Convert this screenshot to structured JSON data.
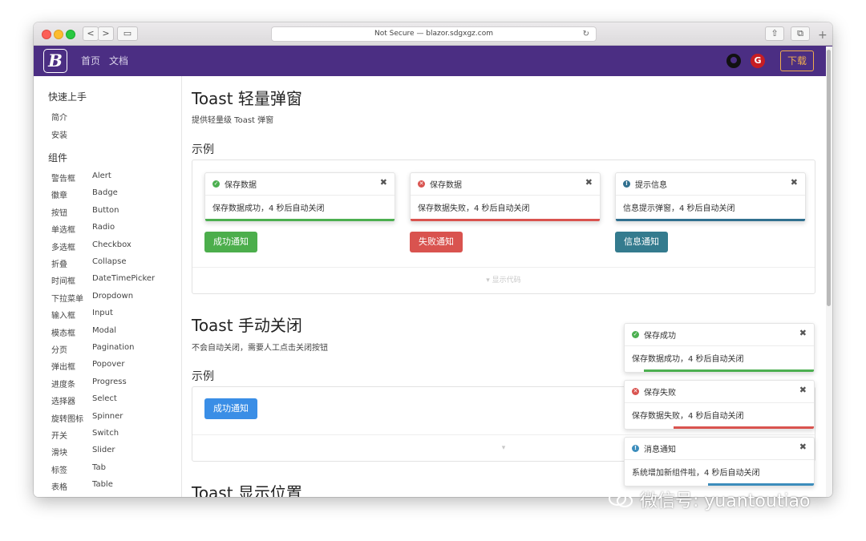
{
  "browser": {
    "url_text": "Not Secure — blazor.sdgxgz.com",
    "back": "<",
    "forward": ">",
    "sidebar_toggle": "▭",
    "share": "⇧",
    "tabs": "⧉",
    "new_tab": "+",
    "reload": "↻"
  },
  "header": {
    "logo": "B",
    "nav": [
      "首页",
      "文档"
    ],
    "gitee": "G",
    "download": "下载"
  },
  "sidebar": {
    "section1": "快速上手",
    "quick": [
      "简介",
      "安装"
    ],
    "section2": "组件",
    "components": [
      {
        "cn": "警告框",
        "en": "Alert"
      },
      {
        "cn": "徽章",
        "en": "Badge"
      },
      {
        "cn": "按钮",
        "en": "Button"
      },
      {
        "cn": "单选框",
        "en": "Radio"
      },
      {
        "cn": "多选框",
        "en": "Checkbox"
      },
      {
        "cn": "折叠",
        "en": "Collapse"
      },
      {
        "cn": "时间框",
        "en": "DateTimePicker"
      },
      {
        "cn": "下拉菜单",
        "en": "Dropdown"
      },
      {
        "cn": "输入框",
        "en": "Input"
      },
      {
        "cn": "模态框",
        "en": "Modal"
      },
      {
        "cn": "分页",
        "en": "Pagination"
      },
      {
        "cn": "弹出框",
        "en": "Popover"
      },
      {
        "cn": "进度条",
        "en": "Progress"
      },
      {
        "cn": "选择器",
        "en": "Select"
      },
      {
        "cn": "旋转图标",
        "en": "Spinner"
      },
      {
        "cn": "开关",
        "en": "Switch"
      },
      {
        "cn": "滑块",
        "en": "Slider"
      },
      {
        "cn": "标签",
        "en": "Tab"
      },
      {
        "cn": "表格",
        "en": "Table"
      }
    ]
  },
  "main": {
    "section1": {
      "title": "Toast 轻量弹窗",
      "desc": "提供轻量级 Toast 弹窗",
      "example": "示例",
      "toasts": [
        {
          "title": "保存数据",
          "body": "保存数据成功，4 秒后自动关闭",
          "icon": "✓",
          "color": "#4caf50"
        },
        {
          "title": "保存数据",
          "body": "保存数据失败，4 秒后自动关闭",
          "icon": "✕",
          "color": "#d9534f"
        },
        {
          "title": "提示信息",
          "body": "信息提示弹窗，4 秒后自动关闭",
          "icon": "!",
          "color": "#31708f"
        }
      ],
      "buttons": [
        {
          "label": "成功通知",
          "color": "#4cae4c"
        },
        {
          "label": "失败通知",
          "color": "#d9534f"
        },
        {
          "label": "信息通知",
          "color": "#347b8e"
        }
      ],
      "show_code": "▾  显示代码"
    },
    "section2": {
      "title": "Toast 手动关闭",
      "desc": "不会自动关闭，需要人工点击关闭按钮",
      "example": "示例",
      "button": "成功通知",
      "show_code": "▾"
    },
    "section3": {
      "title": "Toast 显示位置"
    }
  },
  "floating_toasts": [
    {
      "title": "保存成功",
      "body": "保存数据成功，4 秒后自动关闭",
      "icon": "✓",
      "color": "#4caf50",
      "progress": 0.9
    },
    {
      "title": "保存失败",
      "body": "保存数据失败，4 秒后自动关闭",
      "icon": "✕",
      "color": "#d9534f",
      "progress": 0.74
    },
    {
      "title": "消息通知",
      "body": "系统增加新组件啦，4 秒后自动关闭",
      "icon": "!",
      "color": "#3c8dbc",
      "progress": 0.56
    }
  ],
  "watermark": "微信号: yuantoutiao",
  "close_glyph": "✖"
}
